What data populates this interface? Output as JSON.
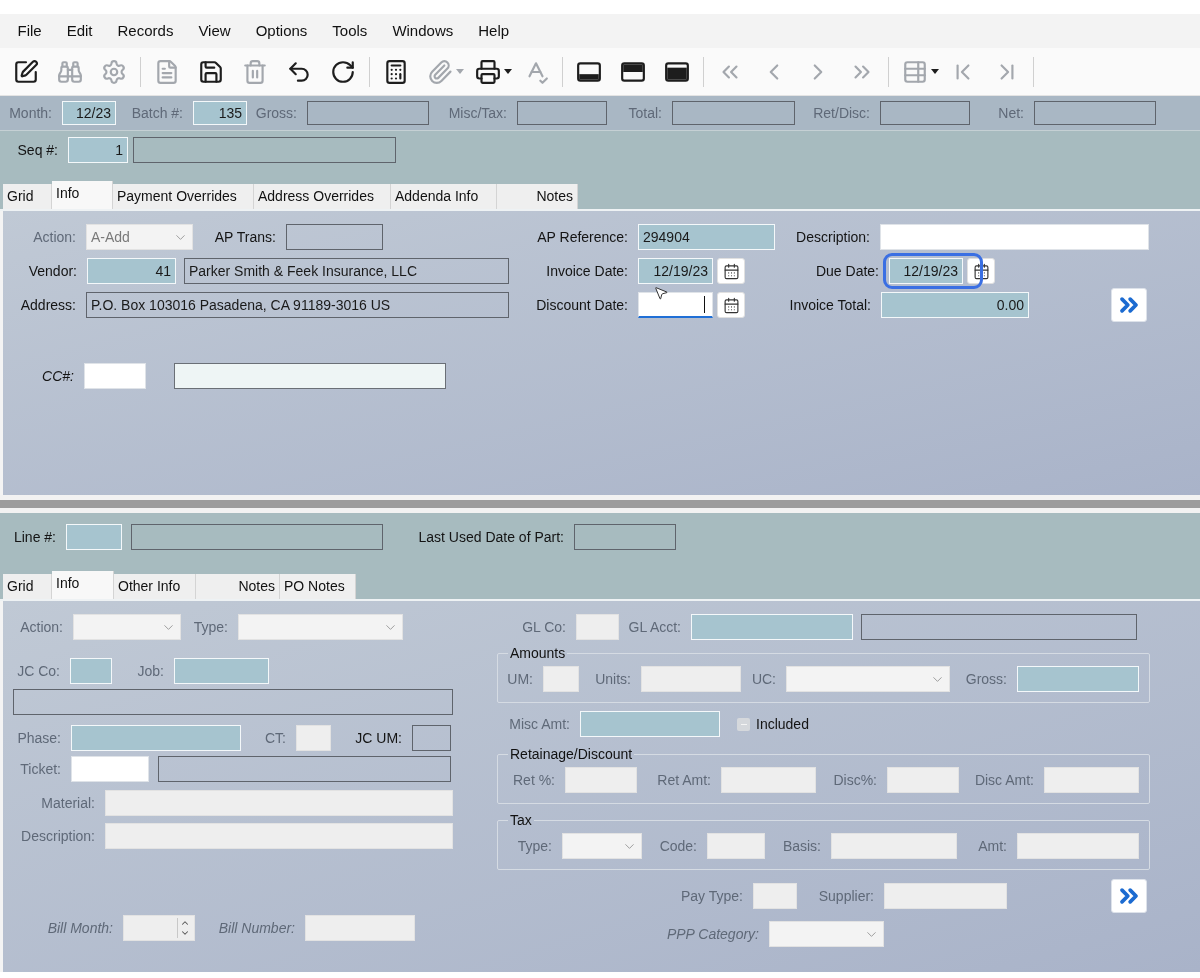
{
  "menu": [
    "File",
    "Edit",
    "Records",
    "View",
    "Options",
    "Tools",
    "Windows",
    "Help"
  ],
  "toolbar": [
    [
      {
        "kind": "edit",
        "disabled": false
      },
      {
        "kind": "find",
        "disabled": true
      },
      {
        "kind": "gear",
        "disabled": true
      }
    ],
    [
      {
        "kind": "document",
        "disabled": true
      },
      {
        "kind": "save",
        "disabled": false
      },
      {
        "kind": "delete",
        "disabled": true
      },
      {
        "kind": "undo",
        "disabled": false
      },
      {
        "kind": "redo",
        "disabled": false
      }
    ],
    [
      {
        "kind": "calculator",
        "disabled": false
      },
      {
        "kind": "attach",
        "disabled": true
      },
      {
        "kind": "caret",
        "disabled": true
      },
      {
        "kind": "print",
        "disabled": false
      },
      {
        "kind": "caret",
        "disabled": false
      },
      {
        "kind": "spellcheck",
        "disabled": true
      }
    ],
    [
      {
        "kind": "pane-bottom",
        "disabled": false
      },
      {
        "kind": "pane-top",
        "disabled": false
      },
      {
        "kind": "pane-full",
        "disabled": false
      }
    ],
    [
      {
        "kind": "first",
        "disabled": true
      },
      {
        "kind": "previous",
        "disabled": true
      },
      {
        "kind": "next",
        "disabled": true
      },
      {
        "kind": "last",
        "disabled": true
      }
    ],
    [
      {
        "kind": "grid-settings",
        "disabled": true
      },
      {
        "kind": "caret",
        "disabled": false
      },
      {
        "kind": "start",
        "disabled": true
      },
      {
        "kind": "end",
        "disabled": true
      }
    ]
  ],
  "header": [
    {
      "label": "Month:",
      "disabled": true,
      "kind": "key",
      "value": "12/23"
    },
    {
      "label": "Batch #:",
      "disabled": true,
      "kind": "key",
      "value": "135"
    },
    {
      "label": "Gross:",
      "disabled": true,
      "kind": "readonly"
    },
    {
      "label": "Misc/Tax:",
      "disabled": true,
      "kind": "readonly"
    },
    {
      "label": "Total:",
      "disabled": true,
      "kind": "readonly"
    },
    {
      "label": "Ret/Disc:",
      "disabled": true,
      "kind": "readonly"
    },
    {
      "label": "Net:",
      "disabled": true,
      "kind": "readonly"
    }
  ],
  "seq": {
    "label": "Seq #:",
    "disabled": false,
    "kind": "key",
    "value": "1"
  },
  "seq_desc": {
    "kind": "readonly"
  },
  "top_tabs": [
    {
      "label": "Grid",
      "selected": false
    },
    {
      "label": "Info",
      "selected": true
    },
    {
      "label": "Payment Overrides",
      "selected": false
    },
    {
      "label": "Address Overrides",
      "selected": false
    },
    {
      "label": "Addenda Info",
      "selected": false
    },
    {
      "label": "Notes",
      "selected": false
    }
  ],
  "top": {
    "action": {
      "label": "Action:",
      "disabled": true,
      "kind": "select",
      "value": "A-Add"
    },
    "ap_trans": {
      "label": "AP Trans:",
      "disabled": false,
      "kind": "readonly"
    },
    "ap_reference": {
      "label": "AP Reference:",
      "disabled": false,
      "kind": "key",
      "value": "294904"
    },
    "description": {
      "label": "Description:",
      "disabled": false,
      "kind": "input"
    },
    "vendor": {
      "label": "Vendor:",
      "disabled": false,
      "kind": "key",
      "value": "41"
    },
    "vendor_name": {
      "kind": "readonly",
      "value": "Parker Smith & Feek Insurance, LLC"
    },
    "invoice_date": {
      "label": "Invoice Date:",
      "disabled": false,
      "kind": "key",
      "value": "12/19/23",
      "focused": false
    },
    "due_date": {
      "label": "Due Date:",
      "disabled": false,
      "kind": "key",
      "value": "12/19/23",
      "highlighted": true
    },
    "address": {
      "label": "Address:",
      "disabled": false,
      "kind": "readonly",
      "value": "P.O. Box 103016  Pasadena, CA  91189-3016  US"
    },
    "discount_date": {
      "label": "Discount Date:",
      "disabled": false,
      "kind": "input",
      "focused": true
    },
    "invoice_total": {
      "label": "Invoice Total:",
      "disabled": false,
      "kind": "key",
      "value": "0.00"
    },
    "cc": {
      "label": "CC#:",
      "disabled": false,
      "kind": "input"
    },
    "cc_desc": {
      "kind": "light"
    }
  },
  "line": {
    "label": "Line #:",
    "disabled": false,
    "kind": "key"
  },
  "line_desc": {
    "kind": "readonly"
  },
  "last_used_date": {
    "label": "Last Used Date of Part:",
    "disabled": false,
    "kind": "readonly"
  },
  "lower_tabs": [
    {
      "label": "Grid",
      "selected": false
    },
    {
      "label": "Info",
      "selected": true
    },
    {
      "label": "Other Info",
      "selected": false
    },
    {
      "label": "Notes",
      "selected": false
    },
    {
      "label": "PO Notes",
      "selected": false
    }
  ],
  "lower": {
    "action": {
      "label": "Action:",
      "disabled": true,
      "kind": "select"
    },
    "type": {
      "label": "Type:",
      "disabled": true,
      "kind": "select"
    },
    "jc_co": {
      "label": "JC Co:",
      "disabled": true,
      "kind": "key"
    },
    "job": {
      "label": "Job:",
      "disabled": true,
      "kind": "key"
    },
    "job_desc": {
      "kind": "readonly"
    },
    "phase": {
      "label": "Phase:",
      "disabled": true,
      "kind": "key"
    },
    "ct": {
      "label": "CT:",
      "disabled": true,
      "kind": "off"
    },
    "jc_um": {
      "label": "JC UM:",
      "disabled": false,
      "kind": "readonly"
    },
    "ticket": {
      "label": "Ticket:",
      "disabled": true,
      "kind": "input"
    },
    "ticket_desc": {
      "kind": "readonly"
    },
    "material": {
      "label": "Material:",
      "disabled": true,
      "kind": "off"
    },
    "description": {
      "label": "Description:",
      "disabled": true,
      "kind": "off"
    },
    "bill_month": {
      "label": "Bill Month:",
      "disabled": true,
      "kind": "spin"
    },
    "bill_number": {
      "label": "Bill Number:",
      "disabled": true,
      "kind": "off"
    },
    "gl_co": {
      "label": "GL Co:",
      "disabled": true,
      "kind": "off"
    },
    "gl_acct": {
      "label": "GL Acct:",
      "disabled": true,
      "kind": "key"
    },
    "gl_desc": {
      "kind": "readonly"
    },
    "amounts": {
      "title": "Amounts",
      "um": {
        "label": "UM:",
        "disabled": true,
        "kind": "off"
      },
      "units": {
        "label": "Units:",
        "disabled": true,
        "kind": "off"
      },
      "uc": {
        "label": "UC:",
        "disabled": true,
        "kind": "select"
      },
      "gross": {
        "label": "Gross:",
        "disabled": true,
        "kind": "key"
      }
    },
    "misc_amt": {
      "label": "Misc Amt:",
      "disabled": true,
      "kind": "key"
    },
    "included": {
      "label": "Included",
      "checked": false
    },
    "retainage": {
      "title": "Retainage/Discount",
      "ret_pct": {
        "label": "Ret %:",
        "disabled": true,
        "kind": "off"
      },
      "ret_amt": {
        "label": "Ret Amt:",
        "disabled": true,
        "kind": "off"
      },
      "disc_pct": {
        "label": "Disc%:",
        "disabled": true,
        "kind": "off"
      },
      "disc_amt": {
        "label": "Disc Amt:",
        "disabled": true,
        "kind": "off"
      }
    },
    "tax": {
      "title": "Tax",
      "type": {
        "label": "Type:",
        "disabled": true,
        "kind": "select"
      },
      "code": {
        "label": "Code:",
        "disabled": true,
        "kind": "off"
      },
      "basis": {
        "label": "Basis:",
        "disabled": true,
        "kind": "off"
      },
      "amt": {
        "label": "Amt:",
        "disabled": true,
        "kind": "off"
      }
    },
    "pay_type": {
      "label": "Pay Type:",
      "disabled": true,
      "kind": "off"
    },
    "supplier": {
      "label": "Supplier:",
      "disabled": true,
      "kind": "off"
    },
    "ppp_category": {
      "label": "PPP Category:",
      "disabled": true,
      "kind": "select"
    }
  }
}
